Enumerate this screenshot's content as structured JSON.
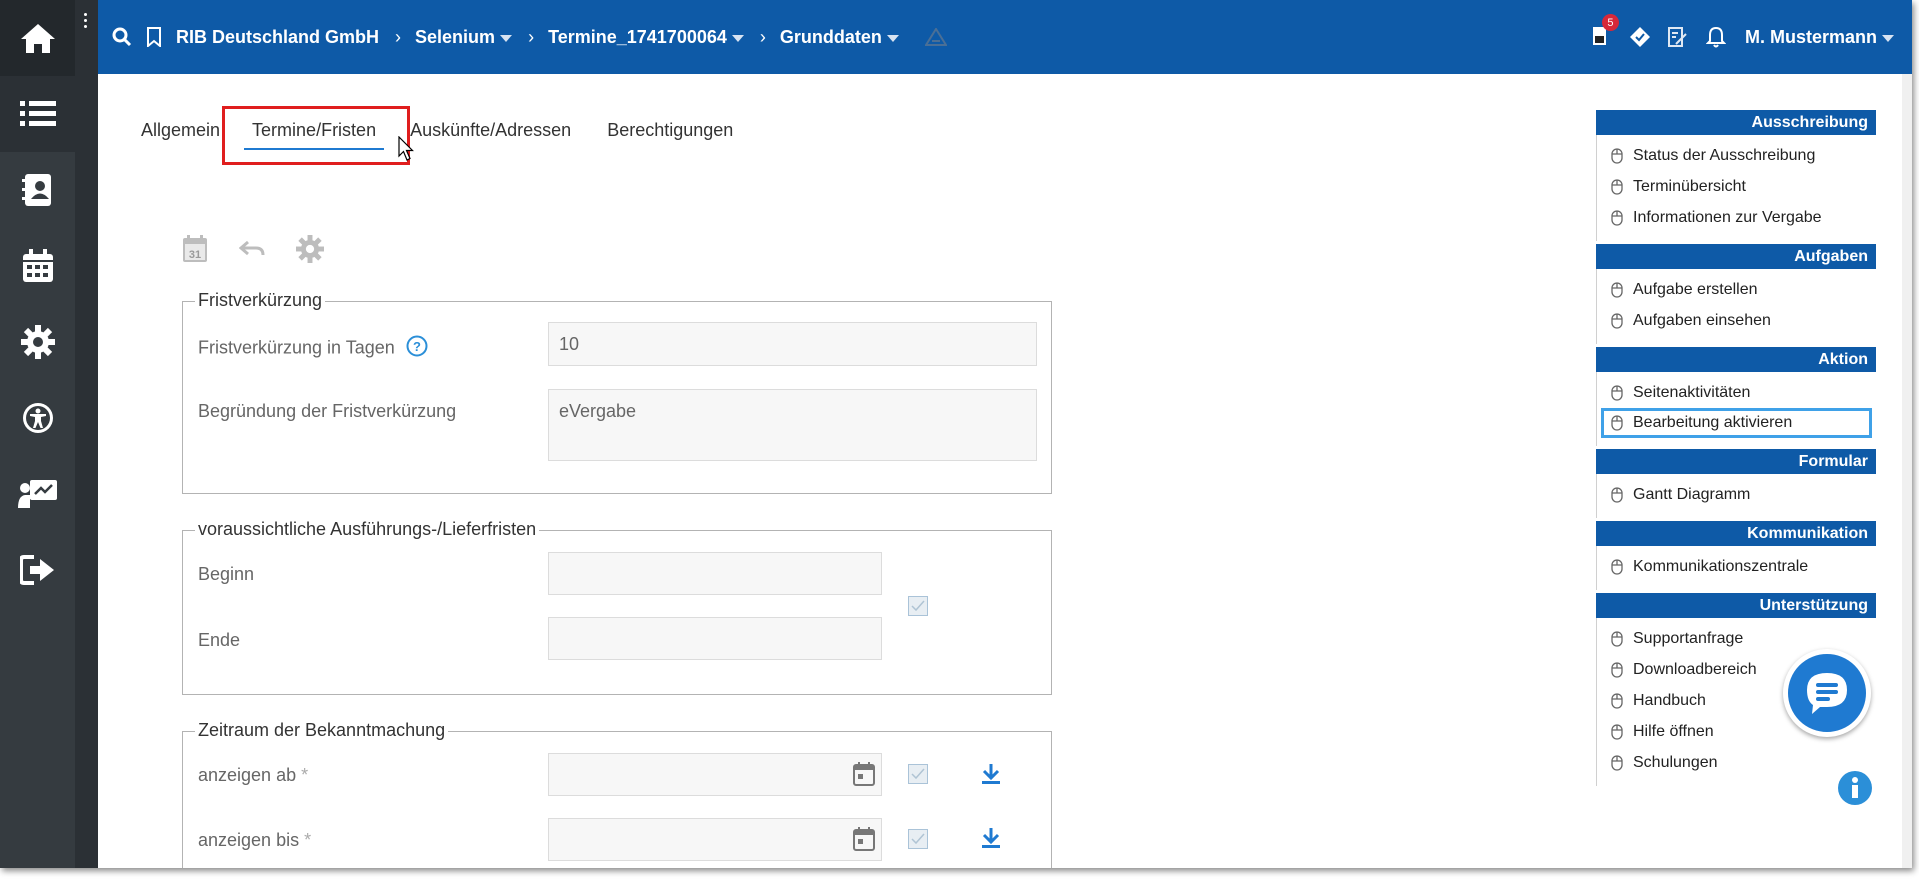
{
  "colors": {
    "header": "#0e5aa7",
    "leftnav": "#353b40",
    "accent": "#1f7ad1",
    "highlight": "#e01e1e",
    "selected_border": "#3fa1e8",
    "badge": "#d62839"
  },
  "leftnav": {
    "icons": [
      "home-icon",
      "list-icon",
      "contacts-icon",
      "calendar-icon",
      "settings-icon",
      "accessibility-icon",
      "presentation-icon",
      "logout-icon"
    ]
  },
  "header": {
    "breadcrumbs": [
      "RIB Deutschland GmbH",
      "Selenium",
      "Termine_1741700064",
      "Grunddaten"
    ],
    "notification_count": "5",
    "user": "M. Mustermann"
  },
  "tabs": [
    "Allgemein",
    "Termine/Fristen",
    "Auskünfte/Adressen",
    "Berechtigungen"
  ],
  "sections": {
    "frist": {
      "legend": "Fristverkürzung",
      "tage_label": "Fristverkürzung in Tagen",
      "tage_value": "10",
      "begruendung_label": "Begründung der Fristverkürzung",
      "begruendung_value": "eVergabe"
    },
    "ausfuehrung": {
      "legend": "voraussichtliche Ausführungs-/Lieferfristen",
      "beginn_label": "Beginn",
      "beginn_value": "",
      "ende_label": "Ende",
      "ende_value": ""
    },
    "bekanntmachung": {
      "legend": "Zeitraum der Bekanntmachung",
      "ab_label": "anzeigen ab",
      "ab_value": "",
      "bis_label": "anzeigen bis",
      "bis_value": "",
      "required_mark": "*"
    }
  },
  "rightpanel": [
    {
      "title": "Ausschreibung",
      "items": [
        "Status der Ausschreibung",
        "Terminübersicht",
        "Informationen zur Vergabe"
      ]
    },
    {
      "title": "Aufgaben",
      "items": [
        "Aufgabe erstellen",
        "Aufgaben einsehen"
      ]
    },
    {
      "title": "Aktion",
      "items": [
        "Seitenaktivitäten",
        "Bearbeitung aktivieren"
      ]
    },
    {
      "title": "Formular",
      "items": [
        "Gantt Diagramm"
      ]
    },
    {
      "title": "Kommunikation",
      "items": [
        "Kommunikationszentrale"
      ]
    },
    {
      "title": "Unterstützung",
      "items": [
        "Supportanfrage",
        "Downloadbereich",
        "Handbuch",
        "Hilfe öffnen",
        "Schulungen"
      ]
    }
  ]
}
